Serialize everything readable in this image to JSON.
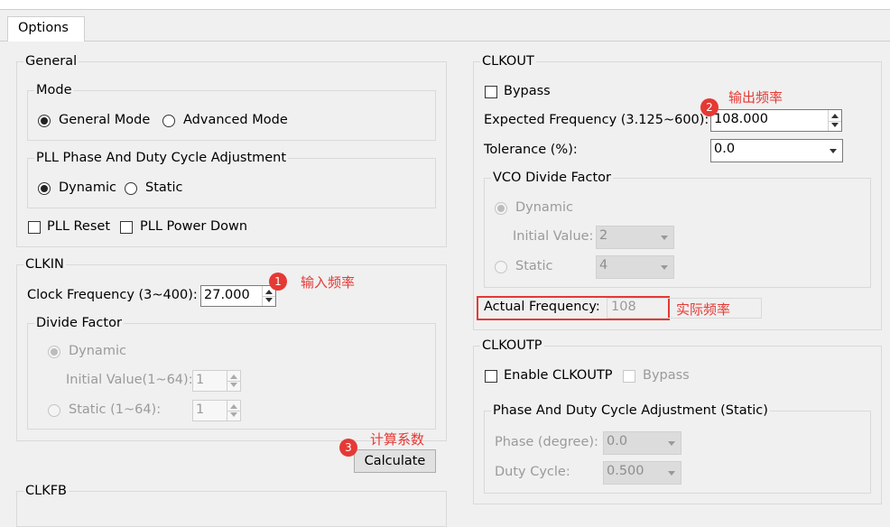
{
  "tab": {
    "label": "Options"
  },
  "general": {
    "title": "General",
    "mode": {
      "title": "Mode",
      "options": [
        "General Mode",
        "Advanced Mode"
      ],
      "selected": "General Mode"
    },
    "pll": {
      "title": "PLL Phase And Duty Cycle Adjustment",
      "options": [
        "Dynamic",
        "Static"
      ],
      "selected": "Dynamic"
    },
    "pll_reset": "PLL Reset",
    "pll_power_down": "PLL Power Down"
  },
  "clkin": {
    "title": "CLKIN",
    "clock_freq_label": "Clock Frequency (3~400):",
    "clock_freq_value": "27.000",
    "divide": {
      "title": "Divide Factor",
      "dynamic_label": "Dynamic",
      "initial_label": "Initial Value(1~64):",
      "initial_value": "1",
      "static_label": "Static (1~64):",
      "static_value": "1"
    }
  },
  "calculate_label": "Calculate",
  "clkfb": {
    "title": "CLKFB"
  },
  "clkout": {
    "title": "CLKOUT",
    "bypass_label": "Bypass",
    "expected_label": "Expected Frequency (3.125~600):",
    "expected_value": "108.000",
    "tolerance_label": "Tolerance (%):",
    "tolerance_value": "0.0",
    "vco": {
      "title": "VCO Divide Factor",
      "dynamic_label": "Dynamic",
      "initial_label": "Initial Value:",
      "initial_value": "2",
      "static_label": "Static",
      "static_value": "4"
    },
    "actual_label": "Actual Frequency:",
    "actual_value": "108"
  },
  "clkoutp": {
    "title": "CLKOUTP",
    "enable_label": "Enable CLKOUTP",
    "bypass_label": "Bypass",
    "phase_group": {
      "title": "Phase And Duty Cycle Adjustment (Static)",
      "phase_label": "Phase (degree):",
      "phase_value": "0.0",
      "duty_label": "Duty Cycle:",
      "duty_value": "0.500"
    }
  },
  "annotations": {
    "a1": {
      "num": "1",
      "text": "输入频率"
    },
    "a2": {
      "num": "2",
      "text": "输出频率"
    },
    "a3": {
      "num": "3",
      "text": "计算系数"
    },
    "actual_note": "实际频率"
  }
}
